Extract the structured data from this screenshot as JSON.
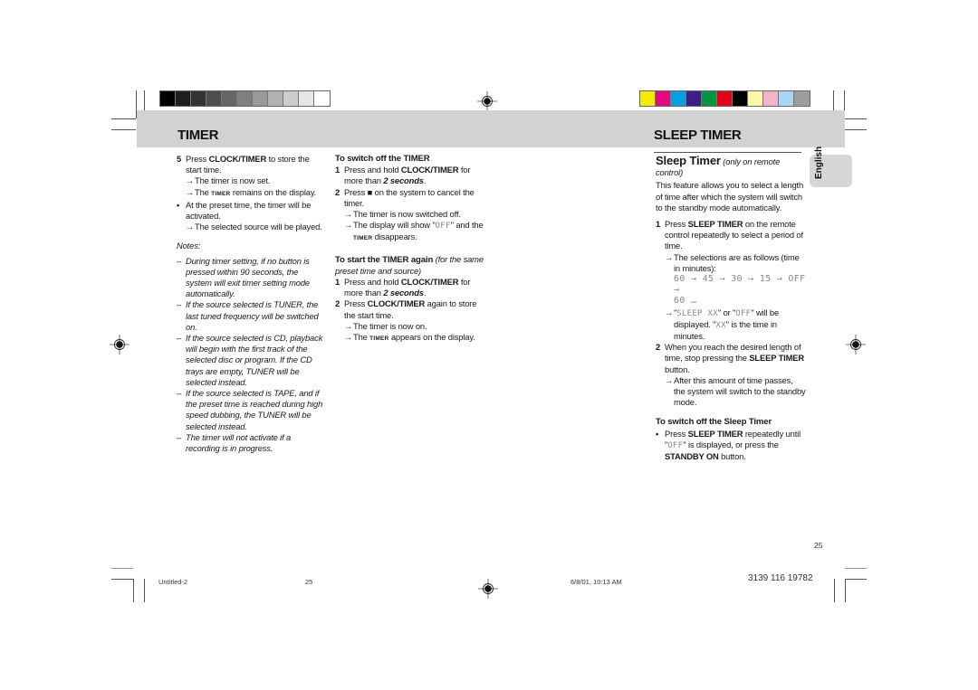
{
  "registration": {
    "grayscale_swatches": [
      "#000000",
      "#1e1e1e",
      "#333333",
      "#4e4e4e",
      "#666666",
      "#7f7f7f",
      "#999999",
      "#b2b2b2",
      "#cccccc",
      "#e6e6e6",
      "#ffffff"
    ],
    "color_swatches": [
      "#f4ec00",
      "#e20a7d",
      "#00a0e3",
      "#3b1f86",
      "#00963f",
      "#e3001b",
      "#000000",
      "#fff6ad",
      "#f5b3cb",
      "#a6d8f3",
      "#9d9d9d"
    ]
  },
  "left_page": {
    "header_title": "TIMER",
    "col1": {
      "step5_num": "5",
      "step5_pre": "Press ",
      "step5_key": "CLOCK/TIMER",
      "step5_post": " to store the start time.",
      "arrow": "→",
      "r1": "The timer is now set.",
      "r2_pre": "The ",
      "r2_key": "TIMER",
      "r2_post": " remains on the display.",
      "bullet": "•",
      "bullet_text": "At the preset time, the timer will be activated.",
      "r3": "The selected source will be played.",
      "notes_label": "Notes:",
      "dash": "–",
      "notes": [
        "During timer setting, if no button is pressed within 90 seconds, the system will exit timer setting mode automatically.",
        "If the source selected is TUNER, the last tuned frequency will be switched on.",
        "If the source selected is CD, playback will begin with the first track of the selected disc or program. If the CD trays are empty, TUNER will be selected instead.",
        "If the source selected is TAPE, and if the preset time is reached during high speed dubbing, the TUNER will be selected instead.",
        "The timer will not activate if a recording is in progress."
      ]
    },
    "col2": {
      "switch_off_heading": "To switch off the TIMER",
      "s1_num": "1",
      "s1_pre": "Press and hold ",
      "s1_key": "CLOCK/TIMER",
      "s1_mid": " for more than ",
      "s1_dur": "2 seconds",
      "s1_end": ".",
      "s2_num": "2",
      "s2_pre": "Press ",
      "s2_icon": "■",
      "s2_post": " on the system to cancel the timer.",
      "arrow": "→",
      "r1": "The timer is now switched off.",
      "r2_pre": "The display will show \"",
      "r2_lcd": "OFF",
      "r2_post": "\" and the",
      "r2_key": "TIMER",
      "r2_end": " disappears.",
      "start_heading": "To start the TIMER again",
      "start_heading_note": " (for the same preset time and source)",
      "a1_num": "1",
      "a1_pre": "Press and hold ",
      "a1_key": "CLOCK/TIMER",
      "a1_mid": " for more than ",
      "a1_dur": "2 seconds",
      "a1_end": ".",
      "a2_num": "2",
      "a2_pre": "Press ",
      "a2_key": "CLOCK/TIMER",
      "a2_post": " again to store the start time.",
      "r3": "The timer is now on.",
      "r4_pre": "The ",
      "r4_key": "TIMER",
      "r4_post": " appears on the display."
    },
    "footer": {
      "file": "Untitled-2",
      "page": "25"
    }
  },
  "right_page": {
    "header_title": "SLEEP TIMER",
    "language_tab": "English",
    "section_title": "Sleep Timer",
    "section_note": "(only on remote control)",
    "intro": "This feature allows you to select a length of time after which the system will switch to the standby mode automatically.",
    "s1_num": "1",
    "s1_pre": "Press ",
    "s1_key": "SLEEP TIMER",
    "s1_post": " on the remote control repeatedly to select a period of time.",
    "arrow": "→",
    "r1": "The selections are as follows (time in minutes):",
    "sequence_line1": "60 → 45 → 30 →  15 → OFF →",
    "sequence_line2": "60 …",
    "r2_q1": "\"",
    "r2_lcd1": "SLEEP XX",
    "r2_mid": "\" or \"",
    "r2_lcd2": "OFF",
    "r2_post": "\" will be displayed. \"",
    "r2_lcd3": "XX",
    "r2_end": "\" is the time in minutes.",
    "s2_num": "2",
    "s2_pre": "When you reach the desired length of time, stop pressing the ",
    "s2_key": "SLEEP TIMER",
    "s2_post": " button.",
    "r3": "After this amount of time passes, the system will switch to the standby mode.",
    "off_heading": "To switch off the Sleep Timer",
    "bullet": "•",
    "b_pre": "Press ",
    "b_key": "SLEEP TIMER",
    "b_mid": " repeatedly until \"",
    "b_lcd": "OFF",
    "b_mid2": "\" is displayed, or press the ",
    "b_key2": "STANDBY ON",
    "b_end": " button.",
    "page_number": "25",
    "footer": {
      "timestamp": "6/8/01, 10:13 AM",
      "doc_code": "3139 116 19782"
    }
  }
}
